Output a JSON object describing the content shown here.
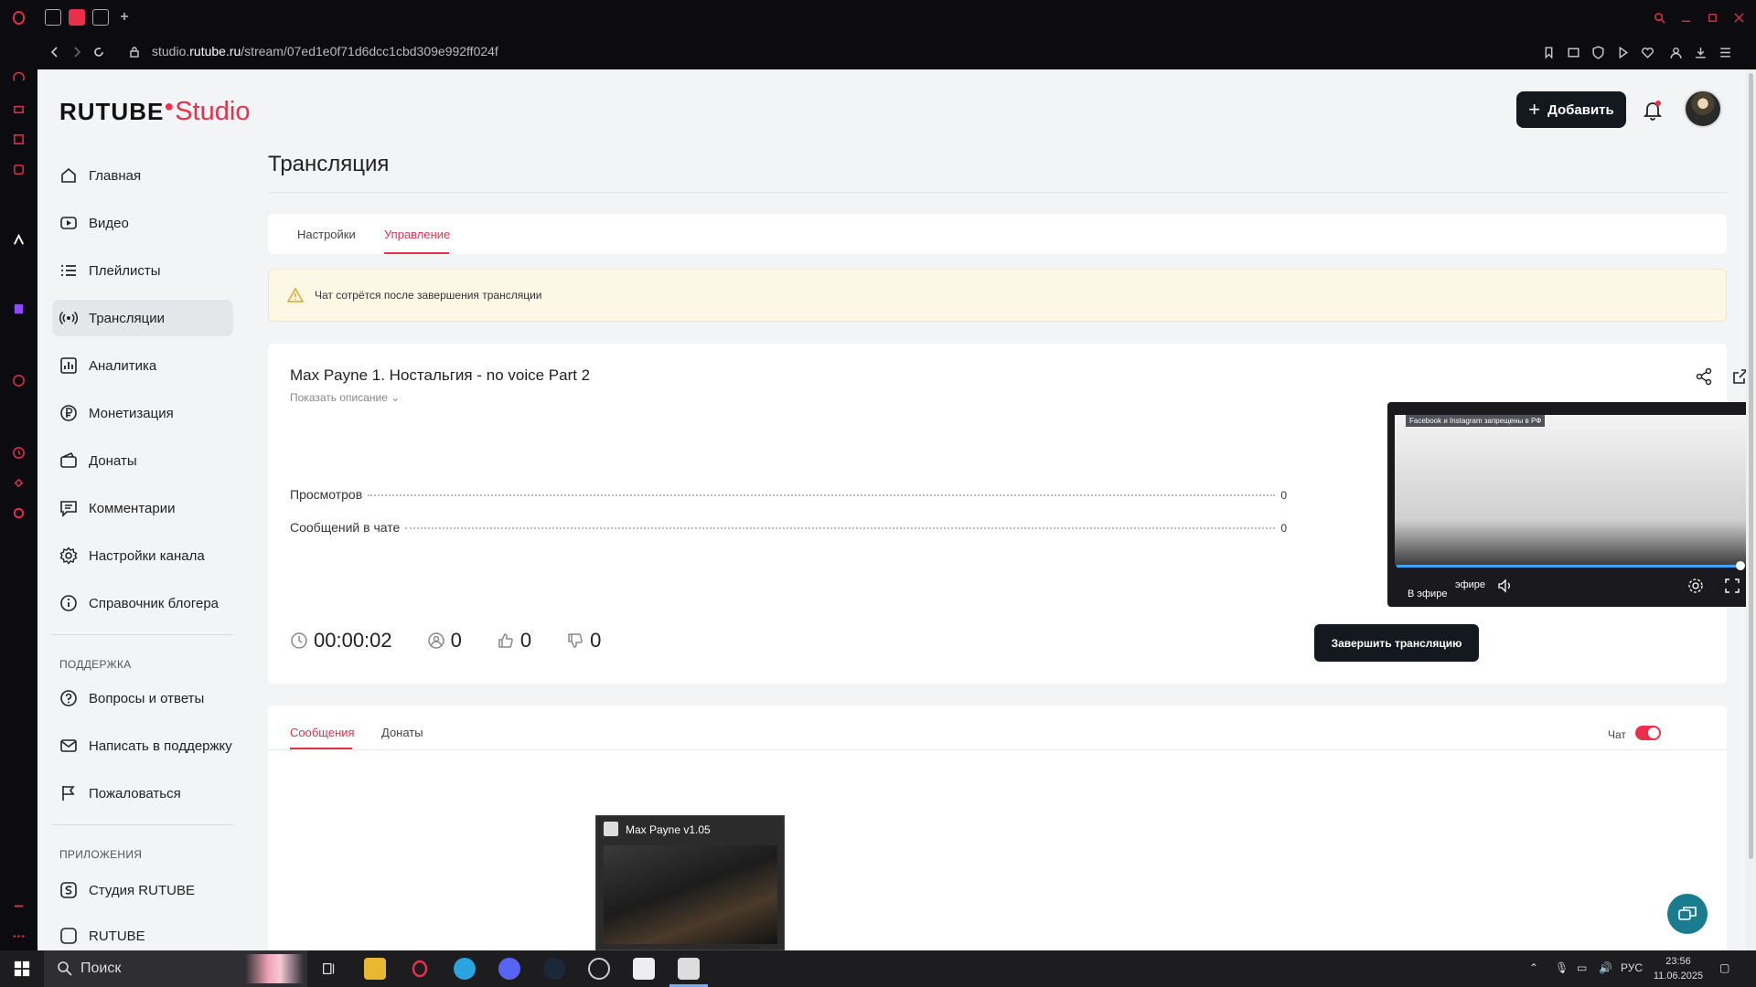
{
  "browser": {
    "url_host": "studio.rutube.ru",
    "url_prefix": "studio.",
    "url_domain": "rutube.ru",
    "url_path": "/stream/07ed1e0f71d6dcc1cbd309e992ff024f"
  },
  "header": {
    "logo_main": "RUTUBE",
    "logo_studio": "Studio",
    "add_label": "Добавить"
  },
  "sidebar": {
    "items": [
      {
        "label": "Главная",
        "icon": "home-icon"
      },
      {
        "label": "Видео",
        "icon": "video-icon"
      },
      {
        "label": "Плейлисты",
        "icon": "playlist-icon"
      },
      {
        "label": "Трансляции",
        "icon": "broadcast-icon"
      },
      {
        "label": "Аналитика",
        "icon": "analytics-icon"
      },
      {
        "label": "Монетизация",
        "icon": "ruble-icon"
      },
      {
        "label": "Донаты",
        "icon": "wallet-icon"
      },
      {
        "label": "Комментарии",
        "icon": "comment-icon"
      },
      {
        "label": "Настройки канала",
        "icon": "gear-icon"
      },
      {
        "label": "Справочник блогера",
        "icon": "info-icon"
      }
    ],
    "support_heading": "ПОДДЕРЖКА",
    "support_items": [
      {
        "label": "Вопросы и ответы",
        "icon": "question-icon"
      },
      {
        "label": "Написать в поддержку",
        "icon": "mail-icon"
      },
      {
        "label": "Пожаловаться",
        "icon": "flag-icon"
      }
    ],
    "apps_heading": "ПРИЛОЖЕНИЯ",
    "apps_items": [
      {
        "label": "Студия RUTUBE",
        "icon": "studio-app-icon"
      },
      {
        "label": "RUTUBE",
        "icon": "rutube-app-icon"
      }
    ]
  },
  "main": {
    "title": "Трансляция",
    "tabs": [
      {
        "label": "Настройки"
      },
      {
        "label": "Управление"
      }
    ],
    "warning": "Чат сотрётся после завершения трансляции",
    "stream": {
      "title": "Max Payne 1. Ностальгия - no voice Part 2",
      "show_description": "Показать описание",
      "views_label": "Просмотров",
      "views_value": "0",
      "chat_msgs_label": "Сообщений в чате",
      "chat_msgs_value": "0",
      "duration": "00:00:02",
      "viewers": "0",
      "likes": "0",
      "dislikes": "0",
      "end_button": "Завершить трансляцию"
    },
    "player": {
      "banner": "Facebook и Instagram запрещены в РФ",
      "live_label": "В эфире",
      "live_label_overlap": "эфире",
      "progress": 1.0
    },
    "chat_tabs": [
      {
        "label": "Сообщения"
      },
      {
        "label": "Донаты"
      }
    ],
    "chat_toggle_label": "Чат",
    "chat_toggle_on": true
  },
  "preview": {
    "title": "Max Payne v1.05"
  },
  "taskbar": {
    "search_label": "Поиск",
    "lang": "РУС",
    "time": "23:56",
    "date": "11.06.2025"
  },
  "colors": {
    "accent": "#e8304c",
    "dark_button": "#14181f",
    "warning_bg": "#fdf8e6",
    "fab": "#1a7d8f"
  }
}
